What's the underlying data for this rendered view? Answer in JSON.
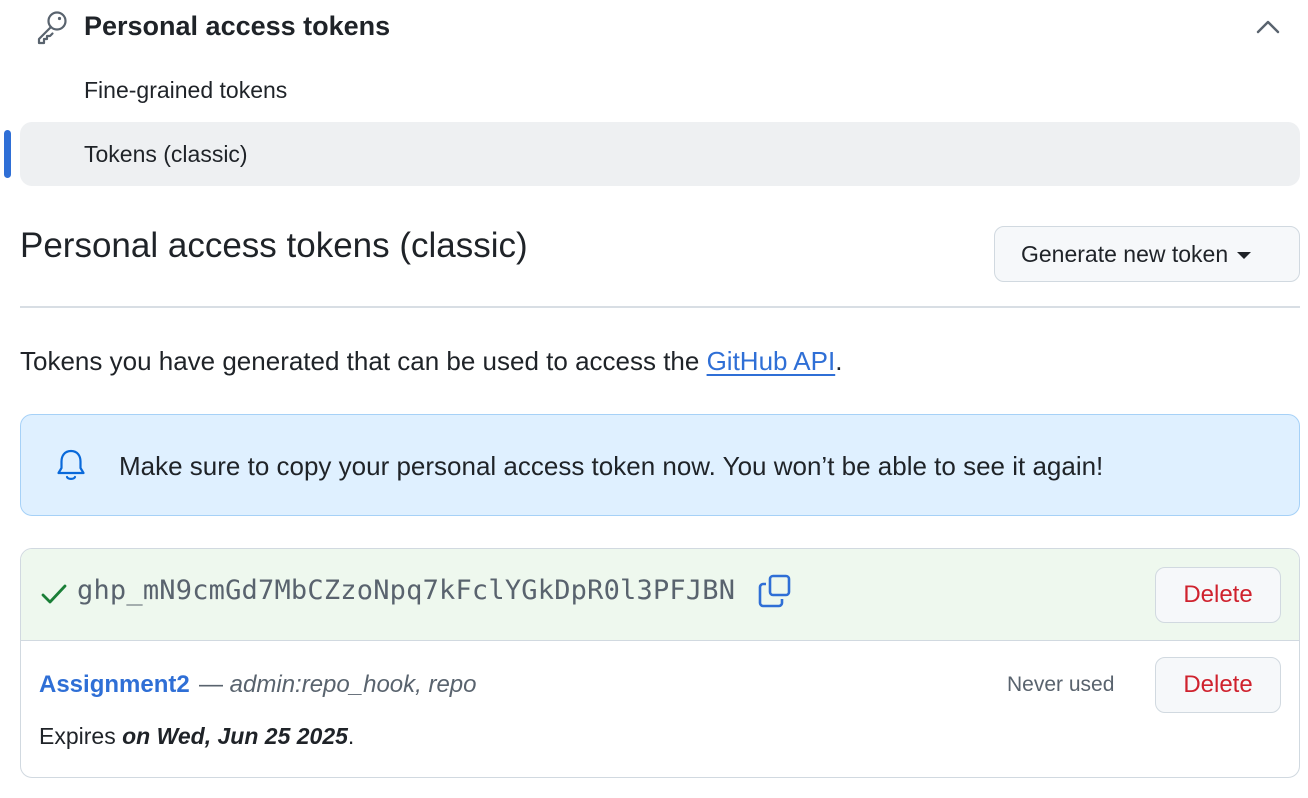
{
  "nav": {
    "section_title": "Personal access tokens",
    "items": [
      {
        "label": "Fine-grained tokens"
      },
      {
        "label": "Tokens (classic)"
      }
    ]
  },
  "header": {
    "title": "Personal access tokens (classic)",
    "generate_button": "Generate new token"
  },
  "intro": {
    "text": "Tokens you have generated that can be used to access the ",
    "link": "GitHub API",
    "suffix": "."
  },
  "flash": {
    "message": "Make sure to copy your personal access token now. You won’t be able to see it again!"
  },
  "new_token": {
    "value": "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",
    "delete_label": "Delete"
  },
  "tokens": [
    {
      "name": "Assignment2",
      "separator": "—",
      "scopes": "admin:repo_hook, repo",
      "last_used": "Never used",
      "delete_label": "Delete",
      "expires_prefix": "Expires ",
      "expires_date": "on Wed, Jun 25 2025",
      "expires_suffix": "."
    }
  ],
  "colors": {
    "accent": "#2f6fd6",
    "danger": "#cf222e",
    "success": "#1a7f37",
    "flash_bg": "#dff0ff",
    "token_bg": "#eef8ee"
  },
  "icons": {
    "nav": "key-icon",
    "collapse": "chevron-up-icon",
    "flash": "bell-icon",
    "token": "check-icon",
    "copy": "copy-icon"
  }
}
